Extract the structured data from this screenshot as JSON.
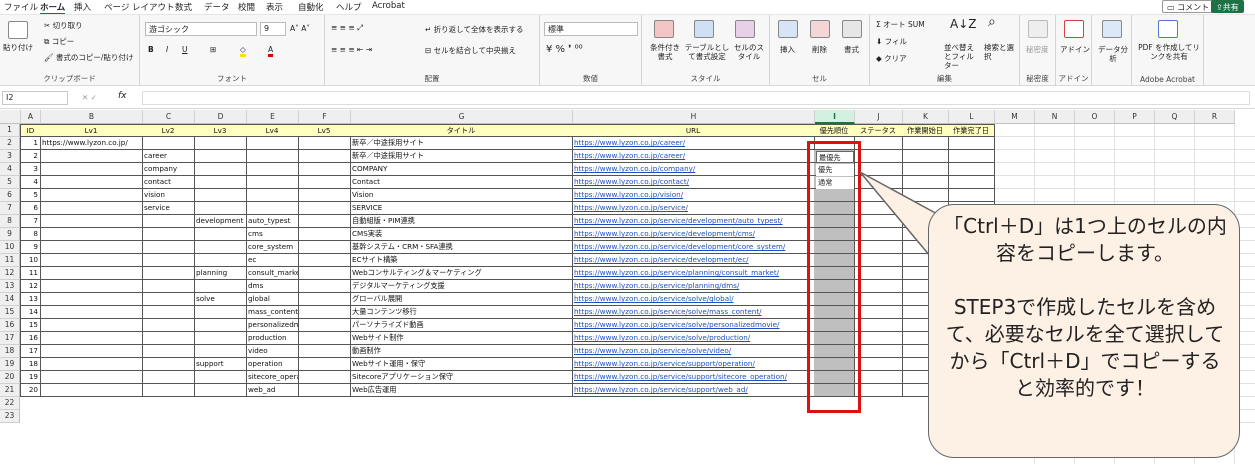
{
  "menu": {
    "tabs": [
      "ファイル",
      "ホーム",
      "挿入",
      "ページ レイアウト",
      "数式",
      "データ",
      "校閲",
      "表示",
      "自動化",
      "ヘルプ",
      "Acrobat"
    ],
    "active": "ホーム",
    "comment_label": "コメント",
    "share_label": "共有"
  },
  "ribbon": {
    "clipboard": {
      "paste": "貼り付け",
      "cut": "切り取り",
      "copy": "コピー",
      "format_painter": "書式のコピー/貼り付け",
      "label": "クリップボード"
    },
    "font": {
      "name": "游ゴシック",
      "size": "9",
      "label": "フォント",
      "bold": "B",
      "italic": "I",
      "underline": "U"
    },
    "alignment": {
      "wrap": "折り返して全体を表示する",
      "merge": "セルを結合して中央揃え",
      "label": "配置"
    },
    "number": {
      "format": "標準",
      "label": "数値"
    },
    "styles": {
      "conditional": "条件付き書式",
      "table": "テーブルとして書式設定",
      "cell_style": "セルのスタイル",
      "label": "スタイル"
    },
    "cells": {
      "insert": "挿入",
      "delete": "削除",
      "format": "書式",
      "label": "セル"
    },
    "editing": {
      "autosum": "オート SUM",
      "fill": "フィル",
      "clear": "クリア",
      "sort": "並べ替えとフィルター",
      "find": "検索と選択",
      "label": "編集"
    },
    "sensitivity": {
      "btn": "秘密度",
      "label": "秘密度"
    },
    "addins": {
      "btn": "アドイン",
      "label": "アドイン"
    },
    "analysis": {
      "btn": "データ分析"
    },
    "acrobat": {
      "btn": "PDF を作成してリンクを共有",
      "label": "Adobe Acrobat"
    }
  },
  "formula_bar": {
    "name_box": "I2",
    "fx": "fx",
    "value": ""
  },
  "columns": [
    "A",
    "B",
    "C",
    "D",
    "E",
    "F",
    "G",
    "H",
    "I",
    "J",
    "K",
    "L",
    "M",
    "N",
    "O",
    "P",
    "Q",
    "R"
  ],
  "selected_column": "I",
  "header_row": {
    "A": "ID",
    "B": "Lv1",
    "C": "Lv2",
    "D": "Lv3",
    "E": "Lv4",
    "F": "Lv5",
    "G": "タイトル",
    "H": "URL",
    "I": "優先順位",
    "J": "ステータス",
    "K": "作業開始日",
    "L": "作業完了日"
  },
  "rows": [
    {
      "A": "1",
      "B": "https://www.lyzon.co.jp/",
      "C": "",
      "D": "",
      "E": "",
      "F": "",
      "G": "新卒／中途採用サイト",
      "H": "https://www.lyzon.co.jp/career/",
      "I": ""
    },
    {
      "A": "2",
      "B": "",
      "C": "career",
      "D": "",
      "E": "",
      "F": "",
      "G": "新卒／中途採用サイト",
      "H": "https://www.lyzon.co.jp/career/",
      "I": ""
    },
    {
      "A": "3",
      "B": "",
      "C": "company",
      "D": "",
      "E": "",
      "F": "",
      "G": "COMPANY",
      "H": "https://www.lyzon.co.jp/company/",
      "I": ""
    },
    {
      "A": "4",
      "B": "",
      "C": "contact",
      "D": "",
      "E": "",
      "F": "",
      "G": "Contact",
      "H": "https://www.lyzon.co.jp/contact/",
      "I": ""
    },
    {
      "A": "5",
      "B": "",
      "C": "vision",
      "D": "",
      "E": "",
      "F": "",
      "G": "Vision",
      "H": "https://www.lyzon.co.jp/vision/",
      "I": ""
    },
    {
      "A": "6",
      "B": "",
      "C": "service",
      "D": "",
      "E": "",
      "F": "",
      "G": "SERVICE",
      "H": "https://www.lyzon.co.jp/service/",
      "I": ""
    },
    {
      "A": "7",
      "B": "",
      "C": "",
      "D": "development",
      "E": "auto_typest",
      "F": "",
      "G": "自動組版・PIM連携",
      "H": "https://www.lyzon.co.jp/service/development/auto_typest/",
      "I": ""
    },
    {
      "A": "8",
      "B": "",
      "C": "",
      "D": "",
      "E": "cms",
      "F": "",
      "G": "CMS実装",
      "H": "https://www.lyzon.co.jp/service/development/cms/",
      "I": ""
    },
    {
      "A": "9",
      "B": "",
      "C": "",
      "D": "",
      "E": "core_system",
      "F": "",
      "G": "基幹システム・CRM・SFA連携",
      "H": "https://www.lyzon.co.jp/service/development/core_system/",
      "I": ""
    },
    {
      "A": "10",
      "B": "",
      "C": "",
      "D": "",
      "E": "ec",
      "F": "",
      "G": "ECサイト構築",
      "H": "https://www.lyzon.co.jp/service/development/ec/",
      "I": ""
    },
    {
      "A": "11",
      "B": "",
      "C": "",
      "D": "planning",
      "E": "consult_market",
      "F": "",
      "G": "Webコンサルティング＆マーケティング",
      "H": "https://www.lyzon.co.jp/service/planning/consult_market/",
      "I": ""
    },
    {
      "A": "12",
      "B": "",
      "C": "",
      "D": "",
      "E": "dms",
      "F": "",
      "G": "デジタルマーケティング支援",
      "H": "https://www.lyzon.co.jp/service/planning/dms/",
      "I": ""
    },
    {
      "A": "13",
      "B": "",
      "C": "",
      "D": "solve",
      "E": "global",
      "F": "",
      "G": "グローバル展開",
      "H": "https://www.lyzon.co.jp/service/solve/global/",
      "I": ""
    },
    {
      "A": "14",
      "B": "",
      "C": "",
      "D": "",
      "E": "mass_content",
      "F": "",
      "G": "大量コンテンツ移行",
      "H": "https://www.lyzon.co.jp/service/solve/mass_content/",
      "I": ""
    },
    {
      "A": "15",
      "B": "",
      "C": "",
      "D": "",
      "E": "personalizedmovie",
      "F": "",
      "G": "パーソナライズド動画",
      "H": "https://www.lyzon.co.jp/service/solve/personalizedmovie/",
      "I": ""
    },
    {
      "A": "16",
      "B": "",
      "C": "",
      "D": "",
      "E": "production",
      "F": "",
      "G": "Webサイト制作",
      "H": "https://www.lyzon.co.jp/service/solve/production/",
      "I": ""
    },
    {
      "A": "17",
      "B": "",
      "C": "",
      "D": "",
      "E": "video",
      "F": "",
      "G": "動画制作",
      "H": "https://www.lyzon.co.jp/service/solve/video/",
      "I": ""
    },
    {
      "A": "18",
      "B": "",
      "C": "",
      "D": "support",
      "E": "operation",
      "F": "",
      "G": "Webサイト運用・保守",
      "H": "https://www.lyzon.co.jp/service/support/operation/",
      "I": ""
    },
    {
      "A": "19",
      "B": "",
      "C": "",
      "D": "",
      "E": "sitecore_operation",
      "F": "",
      "G": "Sitecoreアプリケーション保守",
      "H": "https://www.lyzon.co.jp/service/support/sitecore_operation/",
      "I": ""
    },
    {
      "A": "20",
      "B": "",
      "C": "",
      "D": "",
      "E": "web_ad",
      "F": "",
      "G": "Web広告運用",
      "H": "https://www.lyzon.co.jp/service/support/web_ad/",
      "I": ""
    }
  ],
  "dropdown_options": [
    "最優先",
    "優先",
    "通常"
  ],
  "callout": {
    "line1": "「Ctrl＋D」は1つ上のセルの内容をコピーします。",
    "line2": "STEP3で作成したセルを含めて、必要なセルを全て選択してから「Ctrl＋D」でコピーすると効率的です！"
  },
  "colors": {
    "accent": "#1e7145",
    "highlight_border": "#e01010",
    "header_fill": "#ffffc0",
    "selection_fill": "#bfbfbf",
    "callout_fill": "#fdf0e4"
  }
}
